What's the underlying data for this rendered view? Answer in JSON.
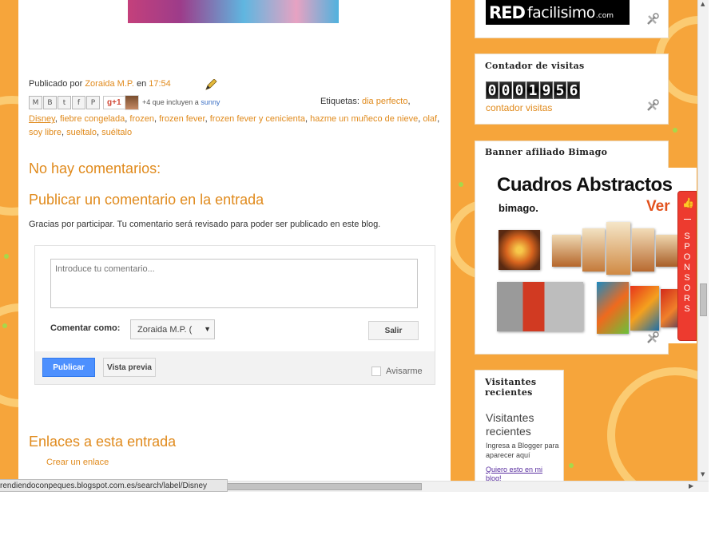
{
  "post": {
    "published_prefix": "Publicado por ",
    "author": "Zoraida M.P.",
    "published_mid": " en ",
    "time": "17:54",
    "share": {
      "buttons": [
        "M",
        "B",
        "t",
        "f",
        "P"
      ],
      "gplus_label": "g+1",
      "plus_text_prefix": "+4 que incluyen a ",
      "plus_user": "sunny"
    },
    "labels_caption": "Etiquetas: ",
    "labels": [
      "dia perfecto",
      "Disney",
      "fiebre congelada",
      "frozen",
      "frozen fever",
      "frozen fever y cenicienta",
      "hazme un muñeco de nieve",
      "olaf",
      "soy libre",
      "sueltalo",
      "suéltalo"
    ]
  },
  "comments": {
    "none_heading": "No hay comentarios:",
    "post_heading": "Publicar un comentario en la entrada",
    "note": "Gracias por participar. Tu comentario será revisado para poder ser publicado en este blog.",
    "textarea_placeholder": "Introduce tu comentario...",
    "comment_as_label": "Comentar como:",
    "identity_value": "Zoraida M.P. (",
    "sign_out_label": "Salir",
    "publish_label": "Publicar",
    "preview_label": "Vista previa",
    "notify_label": "Avisarme"
  },
  "backlinks": {
    "heading": "Enlaces a esta entrada",
    "create_label": "Crear un enlace"
  },
  "sidebar": {
    "red_logo": {
      "part1": "RED",
      "part2": "facilisimo",
      "part3": ".com"
    },
    "counter": {
      "title": "Contador de visitas",
      "digits": [
        "0",
        "0",
        "0",
        "1",
        "9",
        "5",
        "6"
      ],
      "link": "contador visitas"
    },
    "banner": {
      "title": "Banner afiliado Bimago",
      "headline": "Cuadros Abstractos",
      "brand": "bimago.",
      "cta": "Ver"
    },
    "visitors": {
      "title": "Visitantes recientes",
      "heading": "Visitantes recientes",
      "small": "Ingresa a Blogger para aparecer aquí",
      "link": "Quiero esto en mi blog!"
    },
    "sponsors": {
      "text": "SPONSORS"
    }
  },
  "status_bar": {
    "url": "rendiendoconpeques.blogspot.com.es/search/label/Disney"
  },
  "colors": {
    "accent_orange": "#e08a1c",
    "page_bg_orange": "#f6a53b",
    "sponsors_red": "#ed3b2f",
    "publish_blue": "#4d90fe"
  }
}
